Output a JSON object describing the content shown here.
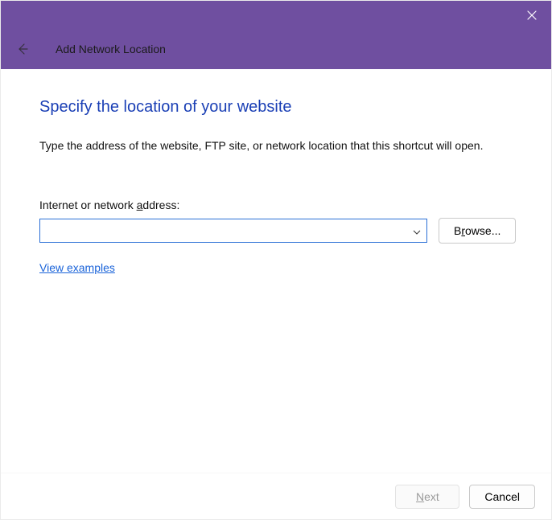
{
  "titlebar": {
    "close_glyph": "✕"
  },
  "header": {
    "title": "Add Network Location"
  },
  "page": {
    "heading": "Specify the location of your website",
    "instruction": "Type the address of the website, FTP site, or network location that this shortcut will open.",
    "field_label_pre": "Internet or network ",
    "field_label_u": "a",
    "field_label_post": "ddress:",
    "address_value": "",
    "browse_pre": "B",
    "browse_u": "r",
    "browse_post": "owse...",
    "examples_link": "View examples"
  },
  "footer": {
    "next_u": "N",
    "next_post": "ext",
    "cancel": "Cancel"
  }
}
